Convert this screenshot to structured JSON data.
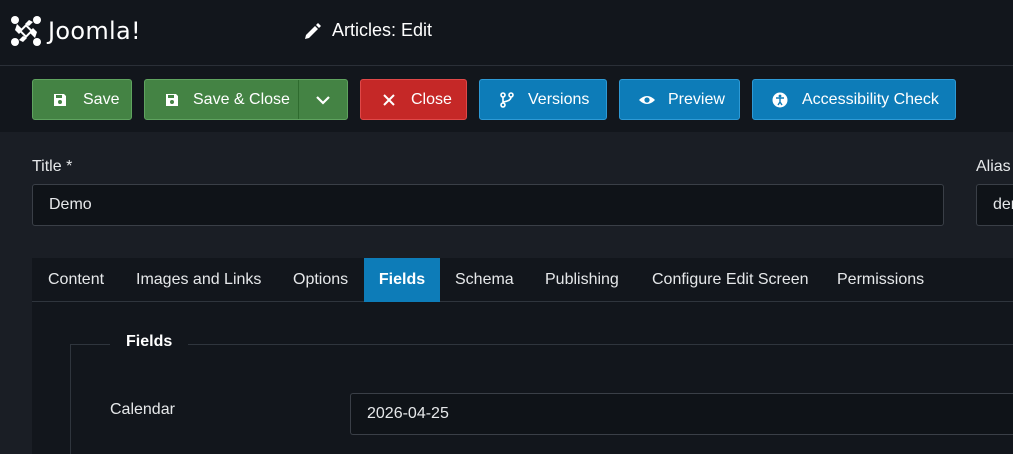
{
  "header": {
    "logo_text": "Joomla!",
    "logo_mark": "joomla-logo",
    "title_icon": "pencil-icon",
    "title": "Articles: Edit"
  },
  "toolbar": {
    "save": "Save",
    "save_close": "Save & Close",
    "close": "Close",
    "versions": "Versions",
    "preview": "Preview",
    "accessibility": "Accessibility Check",
    "icons": {
      "save": "floppy-disk-icon",
      "close": "x-icon",
      "versions": "branch-icon",
      "preview": "eye-icon",
      "accessibility": "universal-access-icon",
      "dropdown": "chevron-down-icon"
    }
  },
  "form": {
    "title_label": "Title *",
    "title_value": "Demo",
    "alias_label": "Alias",
    "alias_value": "demo"
  },
  "tabs": {
    "items": [
      "Content",
      "Images and Links",
      "Options",
      "Fields",
      "Schema",
      "Publishing",
      "Configure Edit Screen",
      "Permissions"
    ],
    "active": "Fields"
  },
  "fields": {
    "legend": "Fields",
    "calendar_label": "Calendar",
    "calendar_value": "2026-04-25"
  },
  "colors": {
    "green": "#448344",
    "red": "#c52827",
    "blue": "#0d7cb8",
    "background": "#1a1e25"
  }
}
